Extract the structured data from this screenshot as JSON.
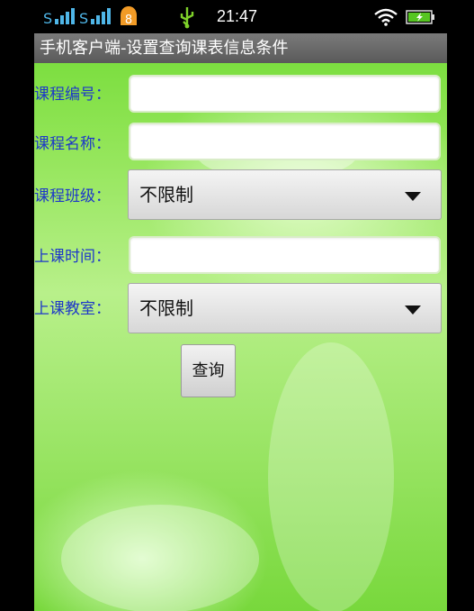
{
  "status_bar": {
    "time": "21:47",
    "notification_badge": "8",
    "icons": [
      "signal-icon",
      "signal-icon-2",
      "notification-badge-icon",
      "usb-icon",
      "wifi-icon",
      "battery-charging-icon"
    ]
  },
  "title_bar": {
    "title": "手机客户端-设置查询课表信息条件"
  },
  "form": {
    "course_number": {
      "label": "课程编号：",
      "value": ""
    },
    "course_name": {
      "label": "课程名称：",
      "value": ""
    },
    "course_class": {
      "label": "课程班级：",
      "selected": "不限制"
    },
    "class_time": {
      "label": "上课时间：",
      "value": ""
    },
    "classroom": {
      "label": "上课教室：",
      "selected": "不限制"
    },
    "query_button": "查询"
  },
  "colors": {
    "label": "#1d37c9",
    "title_bar": "#6a6a6a",
    "background": "#8fe454"
  }
}
